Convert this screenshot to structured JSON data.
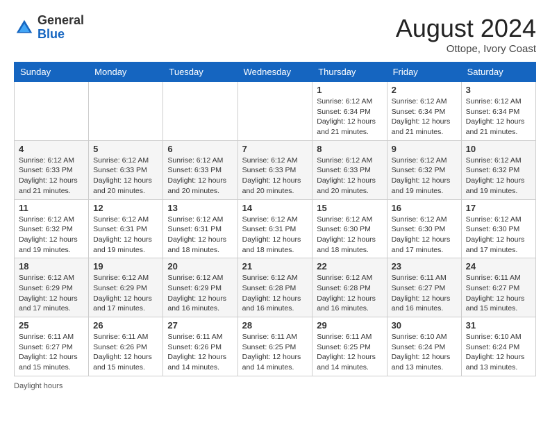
{
  "header": {
    "logo_line1": "General",
    "logo_line2": "Blue",
    "month_year": "August 2024",
    "location": "Ottope, Ivory Coast"
  },
  "footer": {
    "daylight_label": "Daylight hours"
  },
  "days_of_week": [
    "Sunday",
    "Monday",
    "Tuesday",
    "Wednesday",
    "Thursday",
    "Friday",
    "Saturday"
  ],
  "weeks": [
    [
      {
        "day": "",
        "sunrise": "",
        "sunset": "",
        "daylight": ""
      },
      {
        "day": "",
        "sunrise": "",
        "sunset": "",
        "daylight": ""
      },
      {
        "day": "",
        "sunrise": "",
        "sunset": "",
        "daylight": ""
      },
      {
        "day": "",
        "sunrise": "",
        "sunset": "",
        "daylight": ""
      },
      {
        "day": "1",
        "sunrise": "Sunrise: 6:12 AM",
        "sunset": "Sunset: 6:34 PM",
        "daylight": "Daylight: 12 hours and 21 minutes."
      },
      {
        "day": "2",
        "sunrise": "Sunrise: 6:12 AM",
        "sunset": "Sunset: 6:34 PM",
        "daylight": "Daylight: 12 hours and 21 minutes."
      },
      {
        "day": "3",
        "sunrise": "Sunrise: 6:12 AM",
        "sunset": "Sunset: 6:34 PM",
        "daylight": "Daylight: 12 hours and 21 minutes."
      }
    ],
    [
      {
        "day": "4",
        "sunrise": "Sunrise: 6:12 AM",
        "sunset": "Sunset: 6:33 PM",
        "daylight": "Daylight: 12 hours and 21 minutes."
      },
      {
        "day": "5",
        "sunrise": "Sunrise: 6:12 AM",
        "sunset": "Sunset: 6:33 PM",
        "daylight": "Daylight: 12 hours and 20 minutes."
      },
      {
        "day": "6",
        "sunrise": "Sunrise: 6:12 AM",
        "sunset": "Sunset: 6:33 PM",
        "daylight": "Daylight: 12 hours and 20 minutes."
      },
      {
        "day": "7",
        "sunrise": "Sunrise: 6:12 AM",
        "sunset": "Sunset: 6:33 PM",
        "daylight": "Daylight: 12 hours and 20 minutes."
      },
      {
        "day": "8",
        "sunrise": "Sunrise: 6:12 AM",
        "sunset": "Sunset: 6:33 PM",
        "daylight": "Daylight: 12 hours and 20 minutes."
      },
      {
        "day": "9",
        "sunrise": "Sunrise: 6:12 AM",
        "sunset": "Sunset: 6:32 PM",
        "daylight": "Daylight: 12 hours and 19 minutes."
      },
      {
        "day": "10",
        "sunrise": "Sunrise: 6:12 AM",
        "sunset": "Sunset: 6:32 PM",
        "daylight": "Daylight: 12 hours and 19 minutes."
      }
    ],
    [
      {
        "day": "11",
        "sunrise": "Sunrise: 6:12 AM",
        "sunset": "Sunset: 6:32 PM",
        "daylight": "Daylight: 12 hours and 19 minutes."
      },
      {
        "day": "12",
        "sunrise": "Sunrise: 6:12 AM",
        "sunset": "Sunset: 6:31 PM",
        "daylight": "Daylight: 12 hours and 19 minutes."
      },
      {
        "day": "13",
        "sunrise": "Sunrise: 6:12 AM",
        "sunset": "Sunset: 6:31 PM",
        "daylight": "Daylight: 12 hours and 18 minutes."
      },
      {
        "day": "14",
        "sunrise": "Sunrise: 6:12 AM",
        "sunset": "Sunset: 6:31 PM",
        "daylight": "Daylight: 12 hours and 18 minutes."
      },
      {
        "day": "15",
        "sunrise": "Sunrise: 6:12 AM",
        "sunset": "Sunset: 6:30 PM",
        "daylight": "Daylight: 12 hours and 18 minutes."
      },
      {
        "day": "16",
        "sunrise": "Sunrise: 6:12 AM",
        "sunset": "Sunset: 6:30 PM",
        "daylight": "Daylight: 12 hours and 17 minutes."
      },
      {
        "day": "17",
        "sunrise": "Sunrise: 6:12 AM",
        "sunset": "Sunset: 6:30 PM",
        "daylight": "Daylight: 12 hours and 17 minutes."
      }
    ],
    [
      {
        "day": "18",
        "sunrise": "Sunrise: 6:12 AM",
        "sunset": "Sunset: 6:29 PM",
        "daylight": "Daylight: 12 hours and 17 minutes."
      },
      {
        "day": "19",
        "sunrise": "Sunrise: 6:12 AM",
        "sunset": "Sunset: 6:29 PM",
        "daylight": "Daylight: 12 hours and 17 minutes."
      },
      {
        "day": "20",
        "sunrise": "Sunrise: 6:12 AM",
        "sunset": "Sunset: 6:29 PM",
        "daylight": "Daylight: 12 hours and 16 minutes."
      },
      {
        "day": "21",
        "sunrise": "Sunrise: 6:12 AM",
        "sunset": "Sunset: 6:28 PM",
        "daylight": "Daylight: 12 hours and 16 minutes."
      },
      {
        "day": "22",
        "sunrise": "Sunrise: 6:12 AM",
        "sunset": "Sunset: 6:28 PM",
        "daylight": "Daylight: 12 hours and 16 minutes."
      },
      {
        "day": "23",
        "sunrise": "Sunrise: 6:11 AM",
        "sunset": "Sunset: 6:27 PM",
        "daylight": "Daylight: 12 hours and 16 minutes."
      },
      {
        "day": "24",
        "sunrise": "Sunrise: 6:11 AM",
        "sunset": "Sunset: 6:27 PM",
        "daylight": "Daylight: 12 hours and 15 minutes."
      }
    ],
    [
      {
        "day": "25",
        "sunrise": "Sunrise: 6:11 AM",
        "sunset": "Sunset: 6:27 PM",
        "daylight": "Daylight: 12 hours and 15 minutes."
      },
      {
        "day": "26",
        "sunrise": "Sunrise: 6:11 AM",
        "sunset": "Sunset: 6:26 PM",
        "daylight": "Daylight: 12 hours and 15 minutes."
      },
      {
        "day": "27",
        "sunrise": "Sunrise: 6:11 AM",
        "sunset": "Sunset: 6:26 PM",
        "daylight": "Daylight: 12 hours and 14 minutes."
      },
      {
        "day": "28",
        "sunrise": "Sunrise: 6:11 AM",
        "sunset": "Sunset: 6:25 PM",
        "daylight": "Daylight: 12 hours and 14 minutes."
      },
      {
        "day": "29",
        "sunrise": "Sunrise: 6:11 AM",
        "sunset": "Sunset: 6:25 PM",
        "daylight": "Daylight: 12 hours and 14 minutes."
      },
      {
        "day": "30",
        "sunrise": "Sunrise: 6:10 AM",
        "sunset": "Sunset: 6:24 PM",
        "daylight": "Daylight: 12 hours and 13 minutes."
      },
      {
        "day": "31",
        "sunrise": "Sunrise: 6:10 AM",
        "sunset": "Sunset: 6:24 PM",
        "daylight": "Daylight: 12 hours and 13 minutes."
      }
    ]
  ]
}
